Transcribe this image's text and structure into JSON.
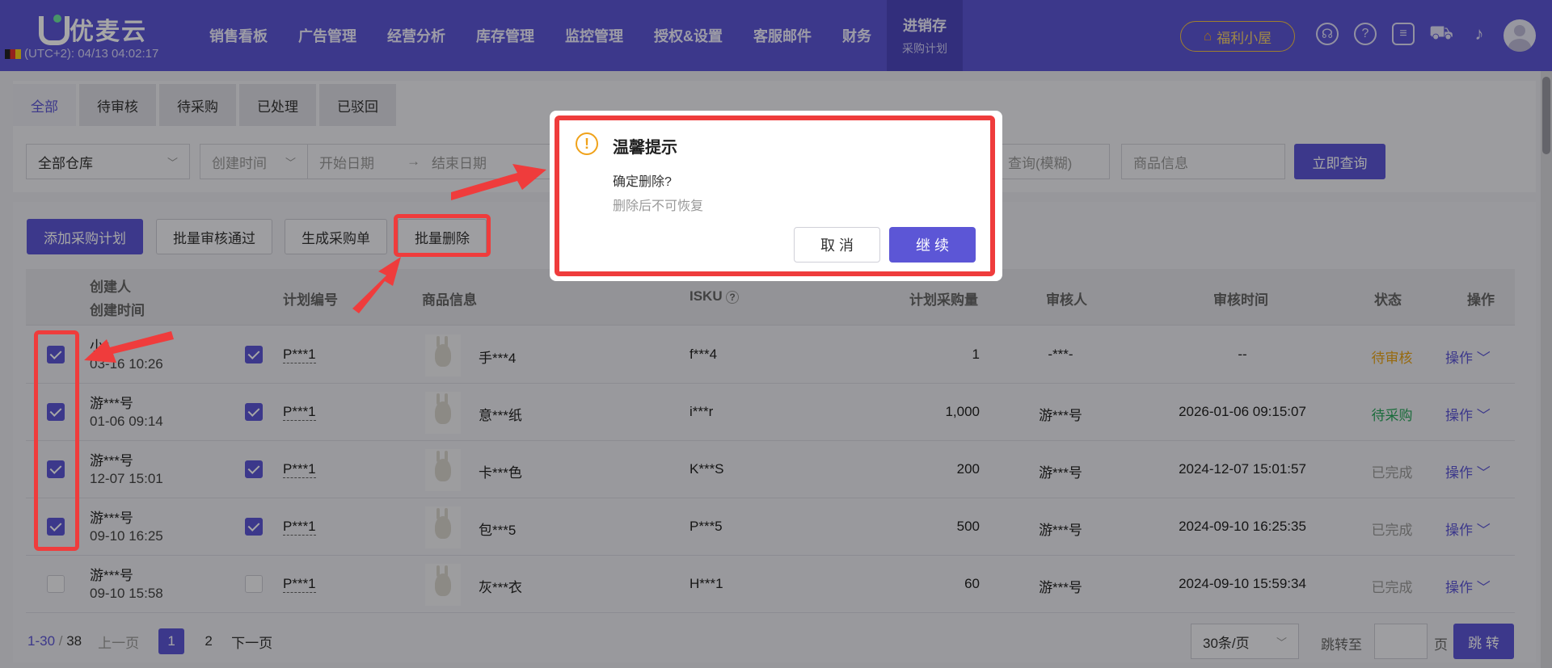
{
  "app": {
    "logo_text": "优麦云",
    "clock": "(UTC+2): 04/13 04:02:17"
  },
  "nav": [
    {
      "label": "销售看板"
    },
    {
      "label": "广告管理"
    },
    {
      "label": "经营分析"
    },
    {
      "label": "库存管理"
    },
    {
      "label": "监控管理"
    },
    {
      "label": "授权&设置"
    },
    {
      "label": "客服邮件"
    },
    {
      "label": "财务"
    },
    {
      "label": "进销存",
      "sub": "采购计划"
    }
  ],
  "welfare": "福利小屋",
  "tabs": [
    "全部",
    "待审核",
    "待采购",
    "已处理",
    "已驳回"
  ],
  "filters": {
    "warehouse": "全部仓库",
    "time_type": "创建时间",
    "start": "开始日期",
    "arrow": "→",
    "end": "结束日期",
    "fuzzy": "查询(模糊)",
    "product": "商品信息",
    "query_btn": "立即查询"
  },
  "actions": {
    "add": "添加采购计划",
    "approve": "批量审核通过",
    "generate": "生成采购单",
    "batch_delete": "批量删除"
  },
  "columns": {
    "creator": "创建人",
    "created": "创建时间",
    "plan_no": "计划编号",
    "product": "商品信息",
    "isku": "ISKU",
    "qty": "计划采购量",
    "reviewer": "审核人",
    "review_time": "审核时间",
    "status": "状态",
    "ops": "操作"
  },
  "rows": [
    {
      "creator": "小*",
      "time": "03-16 10:26",
      "plan": "P***1",
      "product": "手***4",
      "isku": "f***4",
      "qty": "1",
      "reviewer": "-***-",
      "review_time": "--",
      "status": "待审核",
      "status_color": "#e8a317",
      "op": "操作",
      "checked": true
    },
    {
      "creator": "游***号",
      "time": "01-06 09:14",
      "plan": "P***1",
      "product": "意***纸",
      "isku": "i***r",
      "qty": "1,000",
      "reviewer": "游***号",
      "review_time": "2026-01-06 09:15:07",
      "status": "待采购",
      "status_color": "#2aa65c",
      "op": "操作",
      "checked": true
    },
    {
      "creator": "游***号",
      "time": "12-07 15:01",
      "plan": "P***1",
      "product": "卡***色",
      "isku": "K***S",
      "qty": "200",
      "reviewer": "游***号",
      "review_time": "2024-12-07 15:01:57",
      "status": "已完成",
      "status_color": "#999999",
      "op": "操作",
      "checked": true
    },
    {
      "creator": "游***号",
      "time": "09-10 16:25",
      "plan": "P***1",
      "product": "包***5",
      "isku": "P***5",
      "qty": "500",
      "reviewer": "游***号",
      "review_time": "2024-09-10 16:25:35",
      "status": "已完成",
      "status_color": "#999999",
      "op": "操作",
      "checked": true
    },
    {
      "creator": "游***号",
      "time": "09-10 15:58",
      "plan": "P***1",
      "product": "灰***衣",
      "isku": "H***1",
      "qty": "60",
      "reviewer": "游***号",
      "review_time": "2024-09-10 15:59:34",
      "status": "已完成",
      "status_color": "#999999",
      "op": "操作",
      "checked": false
    }
  ],
  "pager": {
    "range": "1-30",
    "sep": " / ",
    "total": "38",
    "prev": "上一页",
    "p1": "1",
    "p2": "2",
    "next": "下一页",
    "size": "30条/页",
    "jump_label": "跳转至",
    "page_unit": "页",
    "jump_btn": "跳 转"
  },
  "modal": {
    "title": "温馨提示",
    "question": "确定删除?",
    "note": "删除后不可恢复",
    "cancel": "取 消",
    "confirm": "继 续"
  },
  "colors": {
    "primary": "#5c56d6",
    "annotation": "#ef3c3c",
    "warning": "#f0a21a"
  }
}
